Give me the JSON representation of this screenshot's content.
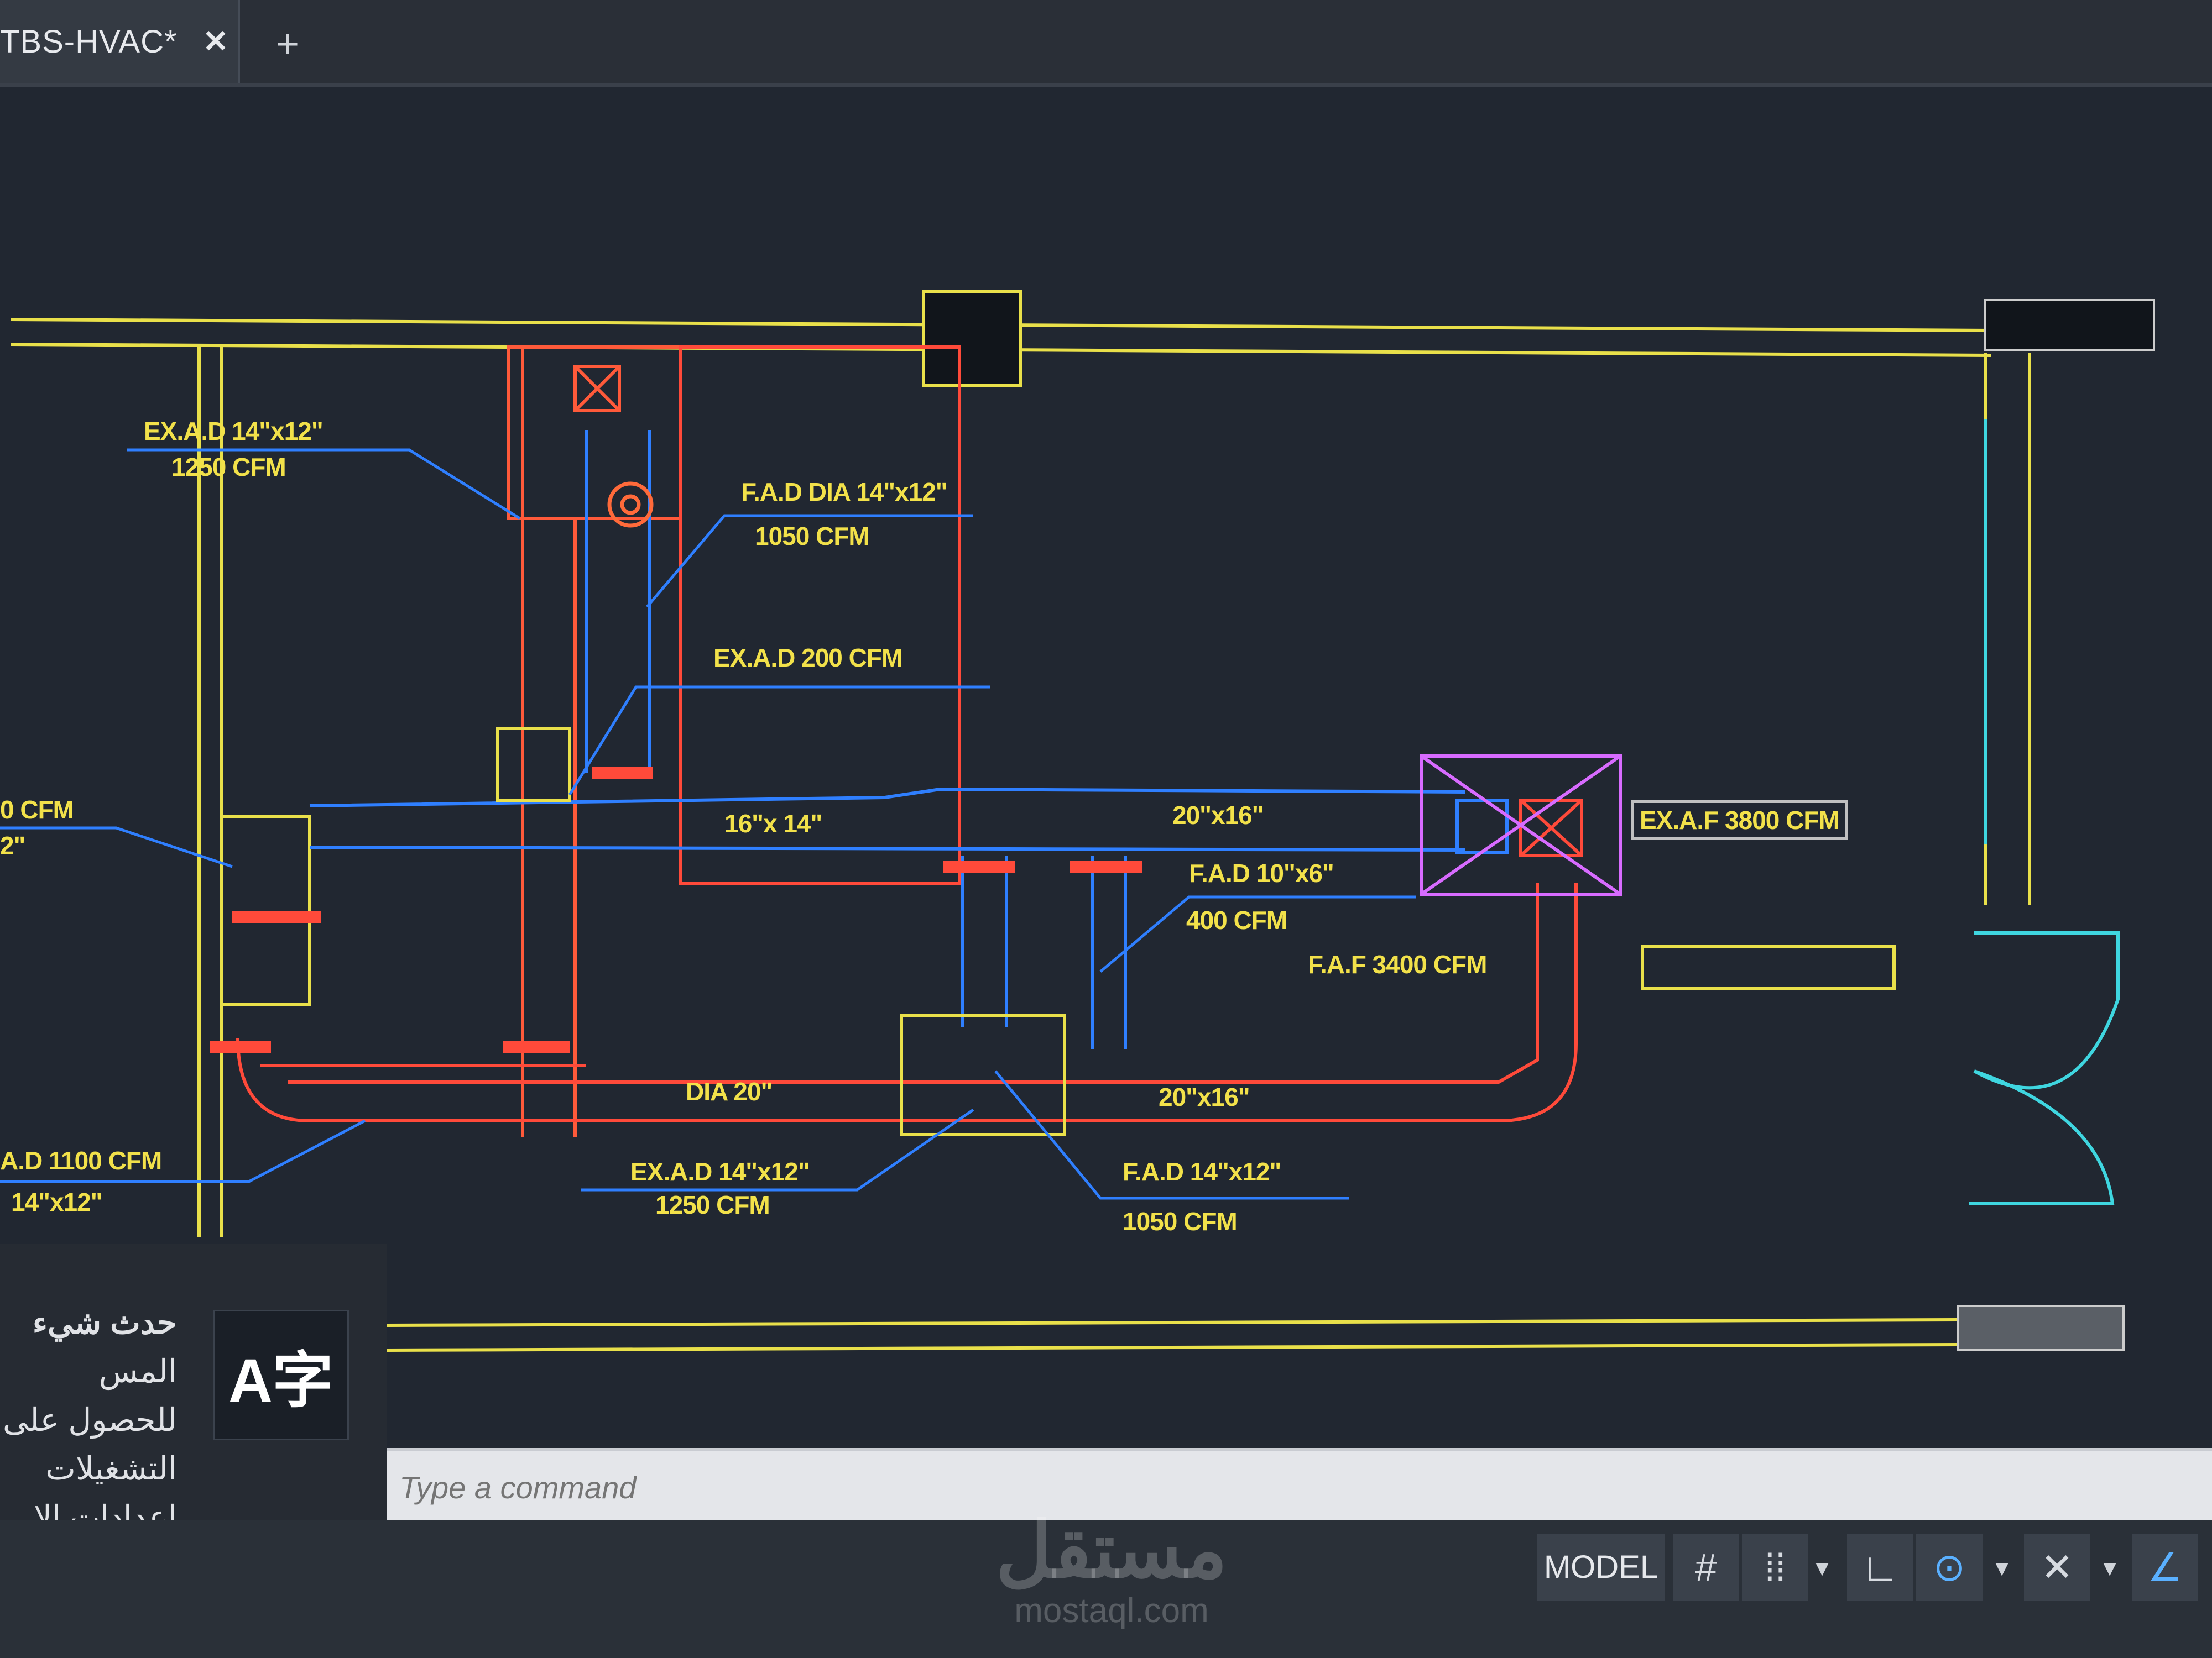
{
  "tabs": {
    "active_label": "TBS-HVAC*",
    "close_glyph": "✕",
    "new_glyph": "+"
  },
  "drawing": {
    "labels": {
      "exad_left_top_1": "EX.A.D  14\"x12\"",
      "exad_left_top_2": "1250 CFM",
      "fad_dia_1": "F.A.D DIA 14\"x12\"",
      "fad_dia_2": "1050 CFM",
      "exad_200": "EX.A.D 200 CFM",
      "left_cfm_partial": "0 CFM",
      "left_size_partial": "2\"",
      "duct_16x14": "16\"x 14\"",
      "duct_20x16_top": "20\"x16\"",
      "exaf_3800": "EX.A.F 3800 CFM",
      "fad_10x6_1": "F.A.D 10\"x6\"",
      "fad_10x6_2": "400 CFM",
      "faf_3400": "F.A.F 3400 CFM",
      "dia_20": "DIA 20\"",
      "duct_20x16_bottom": "20\"x16\"",
      "ad_1100": "A.D 1100 CFM",
      "ad_1100_size": "14\"x12\"",
      "exad_bottom_1": "EX.A.D  14\"x12\"",
      "exad_bottom_2": "1250 CFM",
      "fad_bottom_1": "F.A.D 14\"x12\"",
      "fad_bottom_2": "1050 CFM"
    },
    "colors": {
      "background": "#212731",
      "duct_supply": "#2f7fff",
      "duct_return": "#ff4a3a",
      "walls": "#e9e04a",
      "text": "#f2e14a",
      "door": "#3fd6e0"
    }
  },
  "notification": {
    "title": "حدث شيء",
    "line1": "المس للحصول على",
    "line2": "التشغيلات",
    "line3": "إعدادات الإ",
    "icon": "translate-icon",
    "icon_text": "A字"
  },
  "command": {
    "placeholder": "Type a command"
  },
  "statusbar": {
    "model": "MODEL",
    "grid_icon": "#",
    "snap_icon": "⁞⁞",
    "ortho_icon": "∟",
    "polar_icon": "⊙",
    "osnap_icon": "✕",
    "annot_icon": "∠",
    "dropdown": "▾"
  },
  "watermark": {
    "arabic": "مستقل",
    "latin": "mostaql.com"
  }
}
